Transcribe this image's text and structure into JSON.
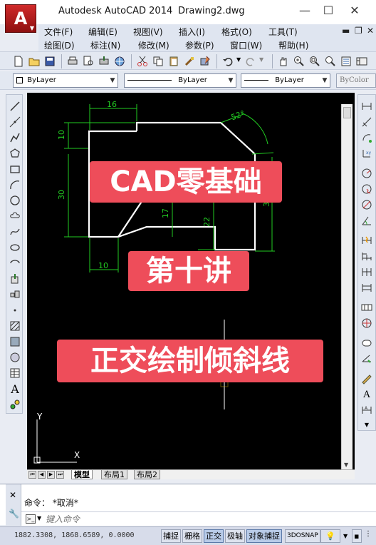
{
  "window": {
    "app_title": "Autodesk AutoCAD 2014",
    "document_name": "Drawing2.dwg",
    "logo_letter": "A"
  },
  "menu": {
    "row1": [
      "文件(F)",
      "编辑(E)",
      "视图(V)",
      "插入(I)",
      "格式(O)",
      "工具(T)"
    ],
    "row2": [
      "绘图(D)",
      "标注(N)",
      "修改(M)",
      "参数(P)",
      "窗口(W)",
      "帮助(H)"
    ]
  },
  "properties_toolbar": {
    "layer": "ByLayer",
    "linetype": "ByLayer",
    "lineweight": "ByLayer",
    "plotstyle": "ByColor"
  },
  "drawing": {
    "dimensions": {
      "top_width": "16",
      "top_height": "10",
      "left_height": "30",
      "bottom_left": "10",
      "mid_height": "17",
      "right_inner": "22",
      "right_outer": "3",
      "angle": "52°"
    },
    "ucs": {
      "x_label": "X",
      "y_label": "Y"
    }
  },
  "overlays": {
    "line1": "CAD零基础",
    "line2": "第十讲",
    "line3": "正交绘制倾斜线"
  },
  "layout_tabs": [
    "模型",
    "布局1",
    "布局2"
  ],
  "command": {
    "history": "命令： *取消*",
    "placeholder": "键入命令"
  },
  "status": {
    "coordinates": "1882.3308, 1868.6589, 0.0000",
    "buttons": [
      {
        "label": "捕捉",
        "on": false
      },
      {
        "label": "栅格",
        "on": false
      },
      {
        "label": "正交",
        "on": true
      },
      {
        "label": "极轴",
        "on": false
      },
      {
        "label": "对象捕捉",
        "on": true
      },
      {
        "label": "3DOSNAP",
        "on": false
      }
    ]
  },
  "colors": {
    "canvas": "#000000",
    "dimension": "#22cc22",
    "geometry": "#ffffff",
    "overlay": "#ee4d5a"
  }
}
